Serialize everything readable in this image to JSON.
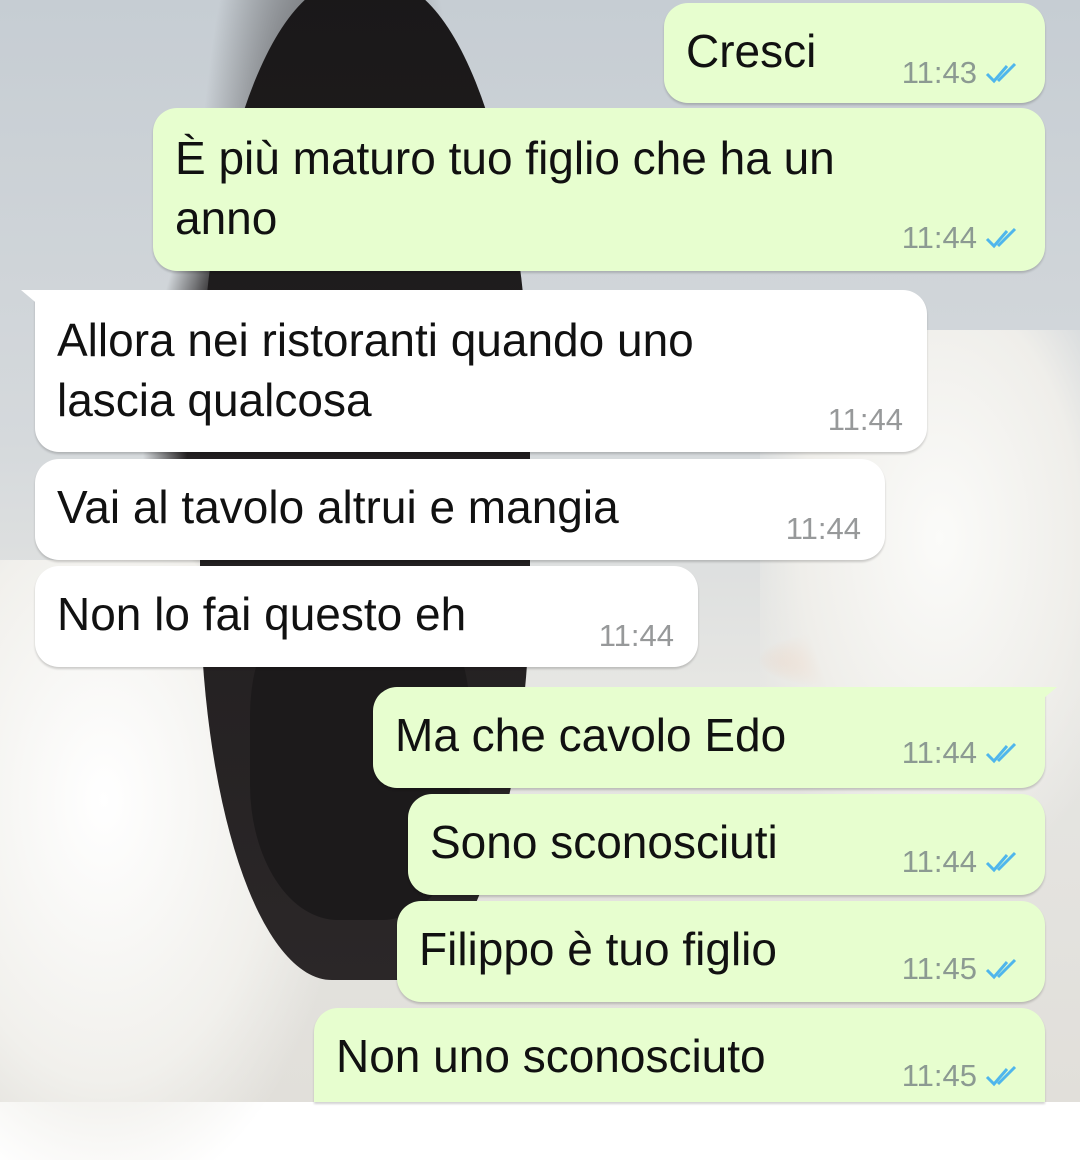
{
  "messages": [
    {
      "text": "Cresci",
      "time": "11:43",
      "direction": "outgoing",
      "status": "read",
      "icon": "double-check-icon"
    },
    {
      "text": "È più maturo tuo figlio che ha un\nanno",
      "time": "11:44",
      "direction": "outgoing",
      "status": "read",
      "icon": "double-check-icon"
    },
    {
      "text": "Allora nei ristoranti quando uno\nlascia qualcosa",
      "time": "11:44",
      "direction": "incoming"
    },
    {
      "text": "Vai al tavolo altrui e mangia",
      "time": "11:44",
      "direction": "incoming"
    },
    {
      "text": "Non lo fai questo eh",
      "time": "11:44",
      "direction": "incoming"
    },
    {
      "text": "Ma che cavolo Edo",
      "time": "11:44",
      "direction": "outgoing",
      "status": "read",
      "icon": "double-check-icon"
    },
    {
      "text": "Sono sconosciuti",
      "time": "11:44",
      "direction": "outgoing",
      "status": "read",
      "icon": "double-check-icon"
    },
    {
      "text": "Filippo è tuo figlio",
      "time": "11:45",
      "direction": "outgoing",
      "status": "read",
      "icon": "double-check-icon"
    },
    {
      "text": "Non uno sconosciuto",
      "time": "11:45",
      "direction": "outgoing",
      "status": "read",
      "icon": "double-check-icon"
    }
  ],
  "colors": {
    "outgoing_bubble": "#e7fecf",
    "incoming_bubble": "#ffffff",
    "read_tick": "#4fb6ec",
    "timestamp": "#8c9a92"
  }
}
